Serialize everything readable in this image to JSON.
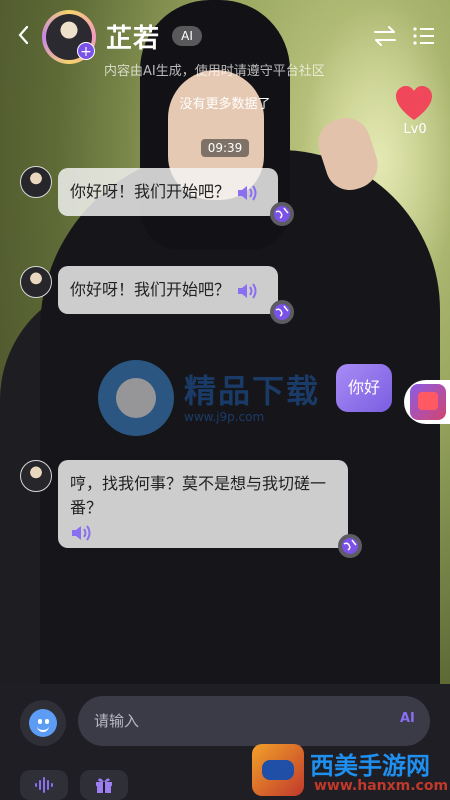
{
  "header": {
    "character_name": "芷若",
    "ai_tag": "AI",
    "disclaimer": "内容由AI生成，使用时请遵守平台社区",
    "back_icon": "chevron-left-icon",
    "switch_icon": "swap-icon",
    "menu_icon": "menu-list-icon",
    "plus_badge": "+"
  },
  "affinity": {
    "heart_icon": "heart-icon",
    "heart_color": "#f0475a",
    "level": "Lv0"
  },
  "chat": {
    "no_more_text": "没有更多数据了",
    "timestamp": "09:39",
    "messages": [
      {
        "role": "bot",
        "text": "你好呀！我们开始吧？"
      },
      {
        "role": "bot",
        "text": "你好呀！我们开始吧？"
      },
      {
        "role": "user",
        "text": "你好"
      },
      {
        "role": "bot",
        "text": "哼，找我何事？莫不是想与我切磋一番？"
      }
    ]
  },
  "watermark": {
    "name": "精品下载",
    "url": "www.j9p.com"
  },
  "composer": {
    "placeholder": "请输入",
    "ai_label": "AI",
    "emoji_icon": "emoji-icon",
    "voice_icon": "voice-wave-icon",
    "gift_icon": "gift-icon"
  },
  "brand": {
    "title": "西美手游网",
    "url": "www.hanxm.com"
  },
  "colors": {
    "accent": "#7a52e8",
    "user_bubble": "#9a7ef2",
    "bottom_bar": "#1e1e24",
    "input_bg": "#3b3b48"
  }
}
